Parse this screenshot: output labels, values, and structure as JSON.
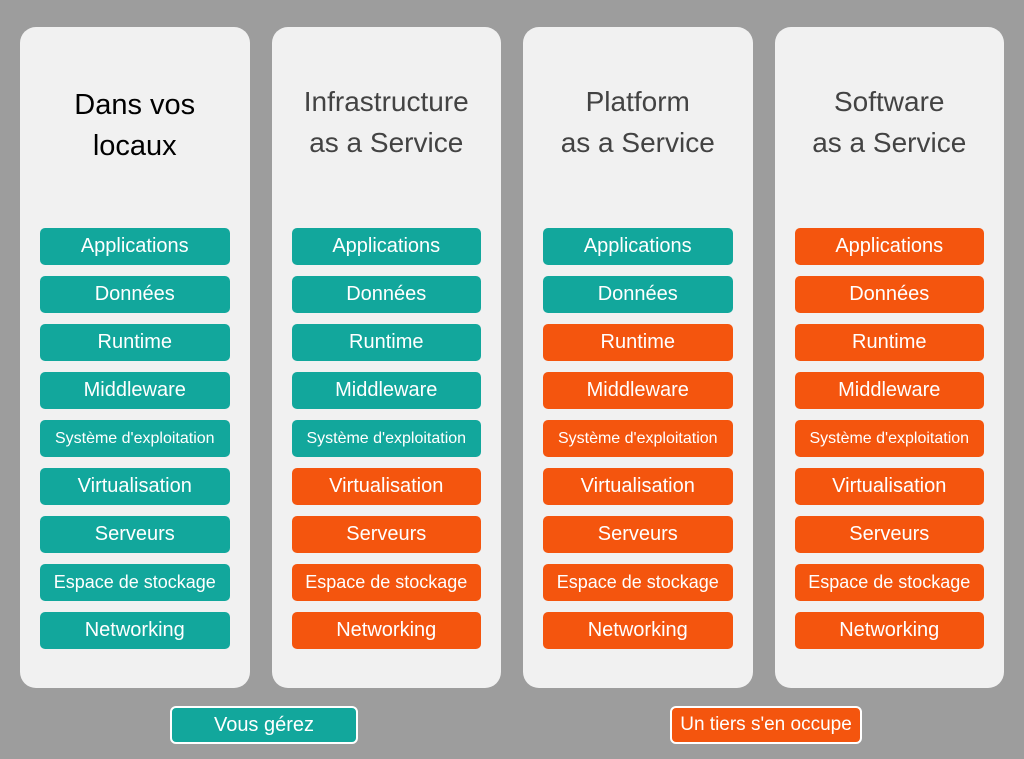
{
  "background_color": "#9d9d9d",
  "card_color": "#f1f1f1",
  "colors": {
    "teal": "#12a79c",
    "orange": "#f4550e",
    "title_dark": "#434343",
    "title_black": "#000000"
  },
  "watermark": {
    "text": ""
  },
  "columns": [
    {
      "id": "on-premises",
      "title": "Dans vos\nlocaux",
      "title_color": "#000000",
      "layers": [
        {
          "label": "Applications",
          "color": "teal",
          "size": "lg"
        },
        {
          "label": "Données",
          "color": "teal",
          "size": "lg"
        },
        {
          "label": "Runtime",
          "color": "teal",
          "size": "lg"
        },
        {
          "label": "Middleware",
          "color": "teal",
          "size": "lg"
        },
        {
          "label": "Système d'exploitation",
          "color": "teal",
          "size": "sm"
        },
        {
          "label": "Virtualisation",
          "color": "teal",
          "size": "lg"
        },
        {
          "label": "Serveurs",
          "color": "teal",
          "size": "lg"
        },
        {
          "label": "Espace de stockage",
          "color": "teal",
          "size": "md"
        },
        {
          "label": "Networking",
          "color": "teal",
          "size": "lg"
        }
      ]
    },
    {
      "id": "iaas",
      "title": "Infrastructure\nas a Service",
      "title_color": "#434343",
      "layers": [
        {
          "label": "Applications",
          "color": "teal",
          "size": "lg"
        },
        {
          "label": "Données",
          "color": "teal",
          "size": "lg"
        },
        {
          "label": "Runtime",
          "color": "teal",
          "size": "lg"
        },
        {
          "label": "Middleware",
          "color": "teal",
          "size": "lg"
        },
        {
          "label": "Système d'exploitation",
          "color": "teal",
          "size": "sm"
        },
        {
          "label": "Virtualisation",
          "color": "orange",
          "size": "lg"
        },
        {
          "label": "Serveurs",
          "color": "orange",
          "size": "lg"
        },
        {
          "label": "Espace de stockage",
          "color": "orange",
          "size": "md"
        },
        {
          "label": "Networking",
          "color": "orange",
          "size": "lg"
        }
      ]
    },
    {
      "id": "paas",
      "title": "Platform\nas a Service",
      "title_color": "#434343",
      "layers": [
        {
          "label": "Applications",
          "color": "teal",
          "size": "lg"
        },
        {
          "label": "Données",
          "color": "teal",
          "size": "lg"
        },
        {
          "label": "Runtime",
          "color": "orange",
          "size": "lg"
        },
        {
          "label": "Middleware",
          "color": "orange",
          "size": "lg"
        },
        {
          "label": "Système d'exploitation",
          "color": "orange",
          "size": "sm"
        },
        {
          "label": "Virtualisation",
          "color": "orange",
          "size": "lg"
        },
        {
          "label": "Serveurs",
          "color": "orange",
          "size": "lg"
        },
        {
          "label": "Espace de stockage",
          "color": "orange",
          "size": "md"
        },
        {
          "label": "Networking",
          "color": "orange",
          "size": "lg"
        }
      ]
    },
    {
      "id": "saas",
      "title": "Software\nas a Service",
      "title_color": "#434343",
      "layers": [
        {
          "label": "Applications",
          "color": "orange",
          "size": "lg"
        },
        {
          "label": "Données",
          "color": "orange",
          "size": "lg"
        },
        {
          "label": "Runtime",
          "color": "orange",
          "size": "lg"
        },
        {
          "label": "Middleware",
          "color": "orange",
          "size": "lg"
        },
        {
          "label": "Système d'exploitation",
          "color": "orange",
          "size": "sm"
        },
        {
          "label": "Virtualisation",
          "color": "orange",
          "size": "lg"
        },
        {
          "label": "Serveurs",
          "color": "orange",
          "size": "lg"
        },
        {
          "label": "Espace de stockage",
          "color": "orange",
          "size": "md"
        },
        {
          "label": "Networking",
          "color": "orange",
          "size": "lg"
        }
      ]
    }
  ],
  "legend": {
    "managed_by_you": "Vous gérez",
    "managed_by_provider": "Un tiers s'en occupe"
  }
}
